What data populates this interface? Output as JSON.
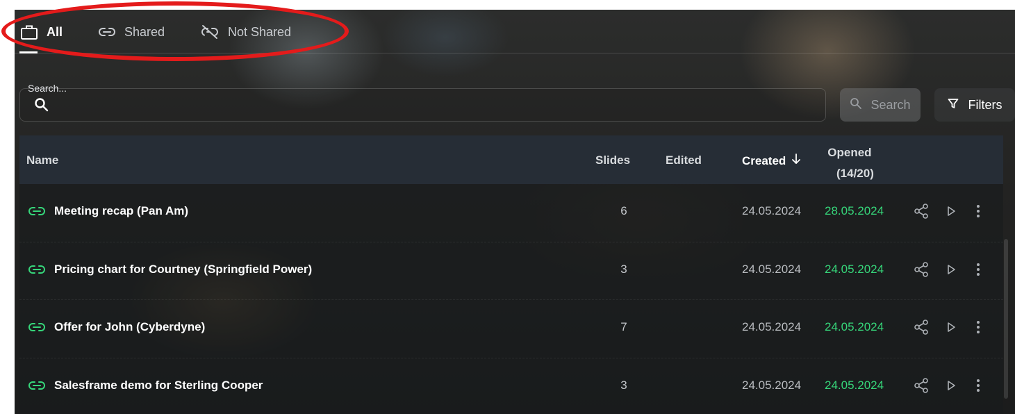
{
  "tabs": [
    {
      "label": "All",
      "icon": "briefcase-icon",
      "active": true
    },
    {
      "label": "Shared",
      "icon": "link-icon",
      "active": false
    },
    {
      "label": "Not Shared",
      "icon": "link-off-icon",
      "active": false
    }
  ],
  "search": {
    "label": "Search...",
    "value": "",
    "button_label": "Search",
    "filters_label": "Filters"
  },
  "table": {
    "columns": {
      "name": "Name",
      "slides": "Slides",
      "edited": "Edited",
      "created": "Created",
      "opened": "Opened",
      "opened_count": "(14/20)"
    },
    "sort": {
      "column": "created",
      "direction": "descending"
    },
    "rows": [
      {
        "title": "Meeting recap (Pan Am)",
        "slides": "6",
        "edited": "",
        "created": "24.05.2024",
        "opened": "28.05.2024",
        "shared": true
      },
      {
        "title": "Pricing chart for Courtney (Springfield Power)",
        "slides": "3",
        "edited": "",
        "created": "24.05.2024",
        "opened": "24.05.2024",
        "shared": true
      },
      {
        "title": "Offer for John (Cyberdyne)",
        "slides": "7",
        "edited": "",
        "created": "24.05.2024",
        "opened": "24.05.2024",
        "shared": true
      },
      {
        "title": "Salesframe demo for Sterling Cooper",
        "slides": "3",
        "edited": "",
        "created": "24.05.2024",
        "opened": "24.05.2024",
        "shared": true
      }
    ]
  },
  "colors": {
    "accent_green": "#36d67a",
    "highlight_red": "#e41b1b",
    "table_header": "#262d36"
  }
}
